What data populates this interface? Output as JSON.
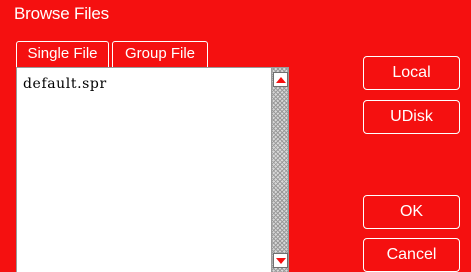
{
  "window": {
    "title": "Browse Files"
  },
  "tabs": [
    {
      "label": "Single File"
    },
    {
      "label": "Group File"
    }
  ],
  "file_list": {
    "items": [
      "default.spr"
    ]
  },
  "buttons": {
    "local": "Local",
    "udisk": "UDisk",
    "ok": "OK",
    "cancel": "Cancel"
  },
  "icons": {
    "scroll_up": "scroll-up-arrow",
    "scroll_down": "scroll-down-arrow"
  },
  "colors": {
    "background": "#f51010",
    "text": "#ffffff",
    "list_background": "#ffffff"
  }
}
